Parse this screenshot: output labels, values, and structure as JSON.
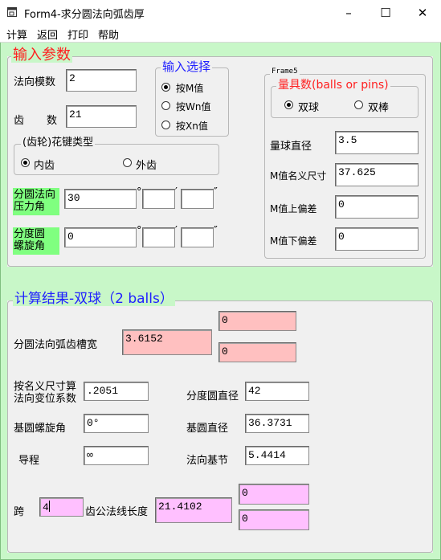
{
  "window": {
    "title": "Form4-求分圆法向弧齿厚",
    "controls": {
      "minimize": "–",
      "maximize": "☐",
      "close": "✕"
    }
  },
  "menu": [
    "计算",
    "返回",
    "打印",
    "帮助"
  ],
  "input_params": {
    "legend": "输入参数",
    "normal_module_label": "法向模数",
    "normal_module_value": "2",
    "teeth_label_1": "齿",
    "teeth_label_2": "数",
    "teeth_value": "21",
    "input_choice": {
      "legend": "输入选择",
      "options": [
        "按M值",
        "按Wn值",
        "按Xn值"
      ],
      "selected": 0
    },
    "spline_type": {
      "legend": "(齿轮)花键类型",
      "options": [
        "内齿",
        "外齿"
      ],
      "selected": 0
    },
    "pressure_angle_label_1": "分圆法向",
    "pressure_angle_label_2": "压力角",
    "pressure_angle": {
      "deg": "30",
      "min": "",
      "sec": ""
    },
    "helix_angle_label_1": "分度圆",
    "helix_angle_label_2": "螺旋角",
    "helix_angle": {
      "deg": "0",
      "min": "",
      "sec": ""
    },
    "deg_symbol": "°",
    "min_symbol": "′",
    "sec_symbol": "″",
    "frame5": {
      "legend": "Frame5",
      "measure": {
        "legend": "量具数(balls or pins)",
        "options": [
          "双球",
          "双棒"
        ],
        "selected": 0
      },
      "ball_diameter_label": "量球直径",
      "ball_diameter_value": "3.5",
      "m_nominal_label": "M值名义尺寸",
      "m_nominal_value": "37.625",
      "m_upper_label": "M值上偏差",
      "m_upper_value": "0",
      "m_lower_label": "M值下偏差",
      "m_lower_value": "0"
    }
  },
  "results": {
    "legend": "计算结果-双球（2 balls）",
    "arc_thickness_label": "分圆法向弧齿槽宽",
    "arc_thickness_value": "3.6152",
    "arc_thickness_upper": "0",
    "arc_thickness_lower": "0",
    "shift_label_1": "按名义尺寸算",
    "shift_label_2": "法向变位系数",
    "shift_value": ".2051",
    "pitch_diameter_label": "分度圆直径",
    "pitch_diameter_value": "42",
    "base_helix_label": "基圆螺旋角",
    "base_helix_value": "0°",
    "base_diameter_label": "基圆直径",
    "base_diameter_value": "36.3731",
    "lead_label": "导程",
    "lead_value": "∞",
    "normal_base_pitch_label": "法向基节",
    "normal_base_pitch_value": "5.4414",
    "span_label": "跨",
    "span_value": "4",
    "common_normal_label": "齿公法线长度",
    "common_normal_value": "21.4102",
    "common_normal_upper": "0",
    "common_normal_lower": "0"
  },
  "colors": {
    "frame_bg": "#c8f7c8",
    "legend_red": "#ff2020",
    "legend_blue": "#2020ff",
    "pink_field": "#ffc0c0",
    "magenta_field": "#ffc0ff",
    "green_label": "#80ff80"
  }
}
